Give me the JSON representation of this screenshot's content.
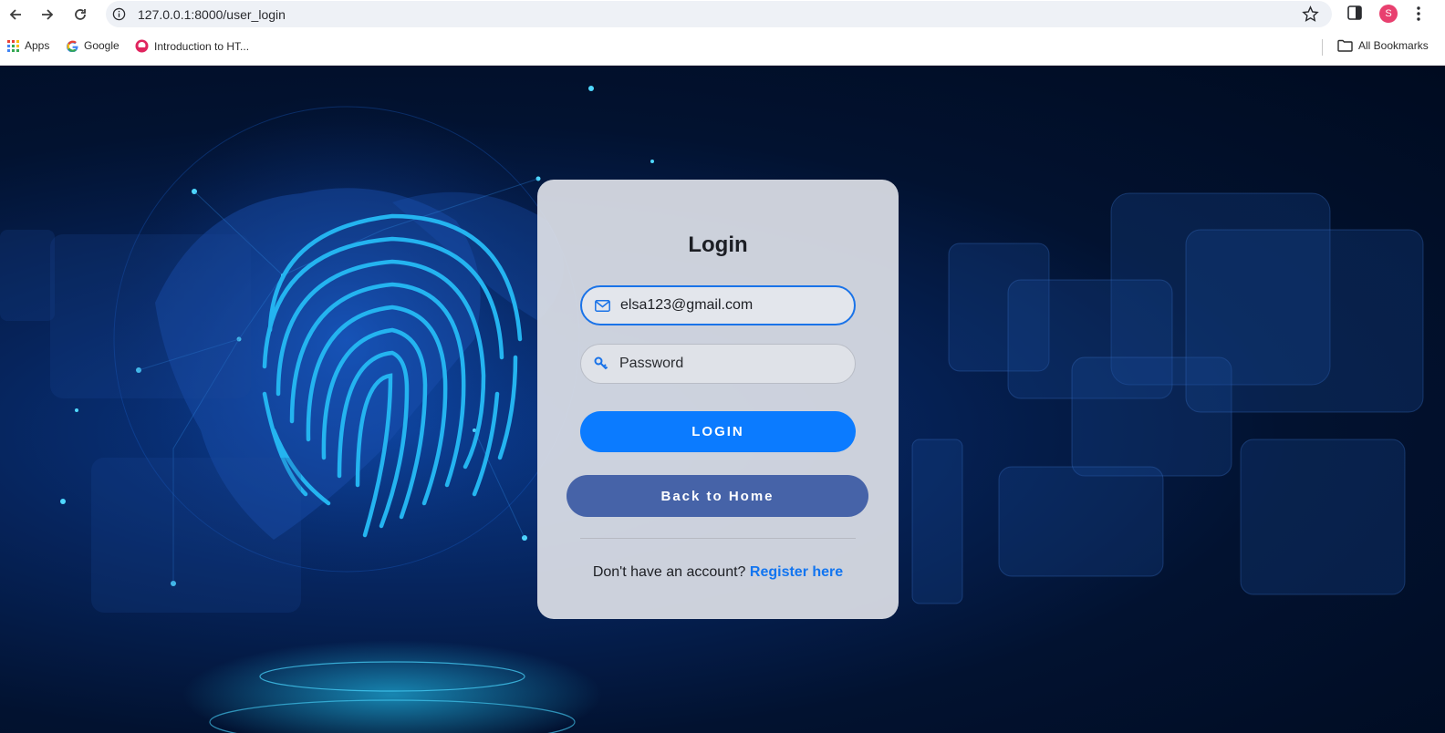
{
  "browser": {
    "url": "127.0.0.1:8000/user_login",
    "avatar_letter": "S",
    "bookmarks": [
      {
        "label": "Apps",
        "icon": "apps-grid-icon"
      },
      {
        "label": "Google",
        "icon": "google-icon"
      },
      {
        "label": "Introduction to HT...",
        "icon": "site-favicon"
      }
    ],
    "all_bookmarks_label": "All Bookmarks"
  },
  "login": {
    "title": "Login",
    "email_value": "elsa123@gmail.com",
    "password_placeholder": "Password",
    "login_button": "LOGIN",
    "back_button": "Back to Home",
    "register_prompt": "Don't have an account?",
    "register_link": "Register here"
  },
  "colors": {
    "primary": "#0b7bff",
    "secondary": "#4663a8",
    "link": "#1275f0",
    "background": "#000d24"
  }
}
